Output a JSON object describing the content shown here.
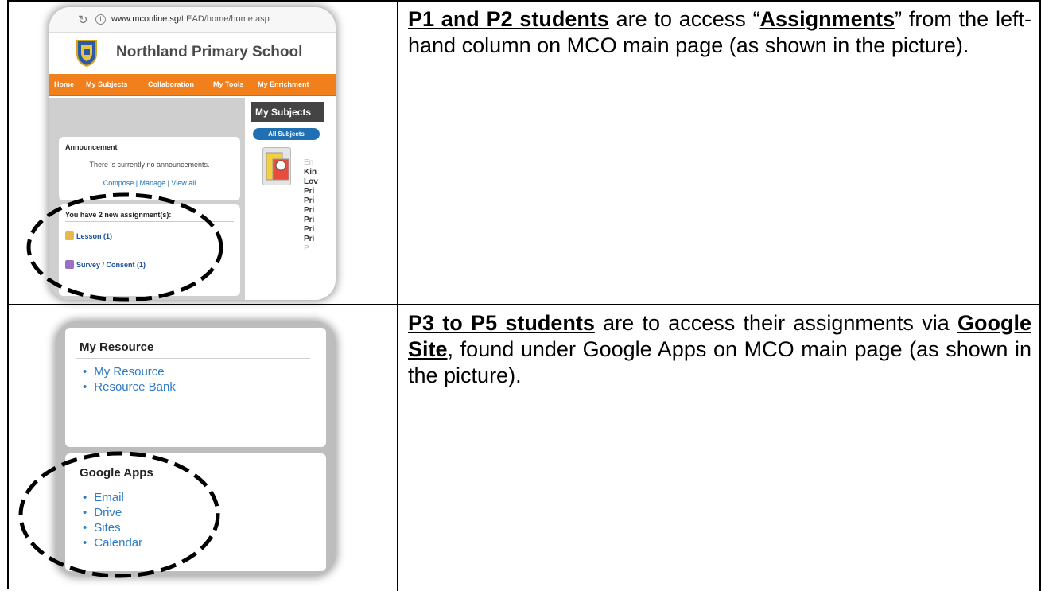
{
  "row1": {
    "para": {
      "lead": "P1 and P2 students",
      "t1": " are to access “",
      "bold": "Assignments",
      "t2": "” from the left-hand column on MCO main page (as shown in the picture)."
    },
    "screenshot": {
      "url_prefix": "www.mconline.sg",
      "url_rest": "/LEAD/home/home.asp",
      "school": "Northland Primary School",
      "nav": [
        "Home",
        "My Subjects",
        "Collaboration",
        "My Tools",
        "My Enrichment"
      ],
      "tab": "My Subjects",
      "all_subjects": "All Subjects",
      "announcement": {
        "title": "Announcement",
        "text": "There is currently no announcements.",
        "links": "Compose | Manage | View all"
      },
      "assignments": {
        "title": "You have 2 new assignment(s):",
        "items": [
          "Lesson (1)",
          "Survey / Consent (1)"
        ]
      },
      "subject_lines": [
        "En",
        "Kin",
        "Lov",
        "Pri",
        "Pri",
        "Pri",
        "Pri",
        "Pri",
        "Pri",
        "P"
      ]
    }
  },
  "row2": {
    "para": {
      "lead": "P3 to P5 students",
      "t1": " are to access their assignments via ",
      "bold": "Google Site",
      "t2": ", found under Google Apps on MCO main page (as shown in the picture)."
    },
    "screenshot": {
      "resource": {
        "title": "My Resource",
        "items": [
          "My Resource",
          "Resource Bank"
        ]
      },
      "apps": {
        "title": "Google Apps",
        "items": [
          "Email",
          "Drive",
          "Sites",
          "Calendar"
        ]
      }
    }
  },
  "colors": {
    "nav_orange": "#f07f1c",
    "link_blue": "#2e7bc4",
    "button_blue": "#1f6fb5"
  }
}
